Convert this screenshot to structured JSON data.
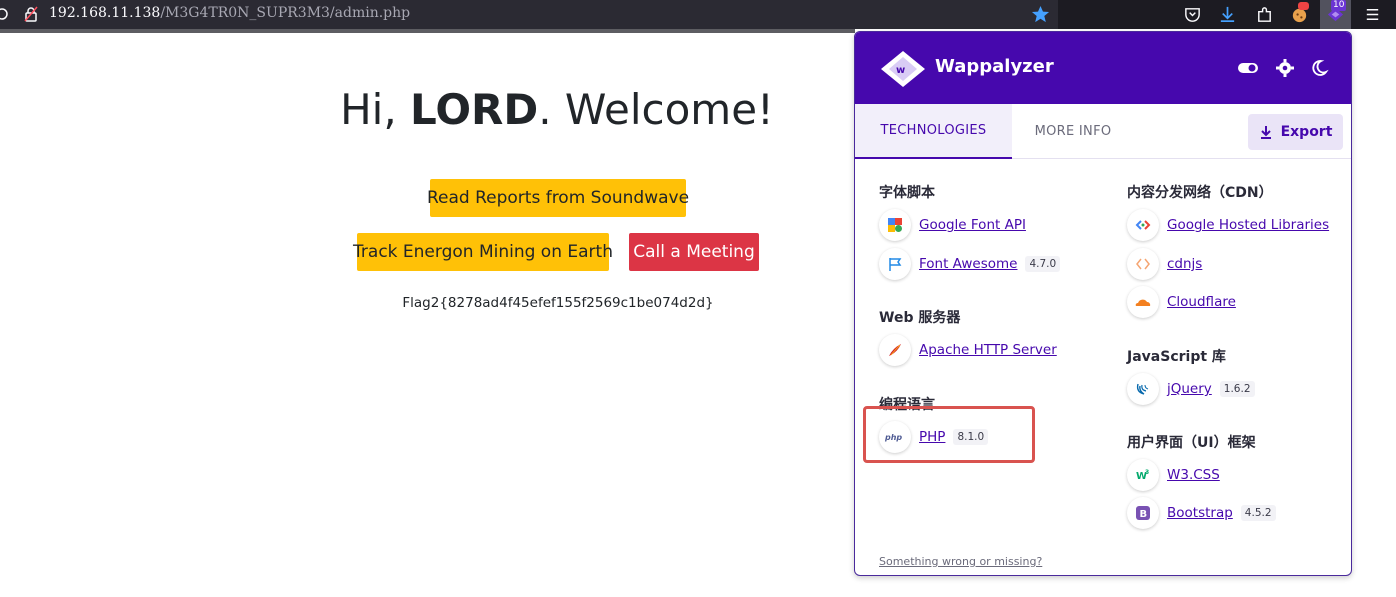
{
  "browser": {
    "url_host": "192.168.11.138",
    "url_path": "/M3G4TR0N_SUPR3M3/admin.php",
    "extension_badge": "10"
  },
  "page": {
    "title_prefix": "Hi, ",
    "title_name": "LORD",
    "title_suffix": ". Welcome!",
    "buttons": {
      "read_reports": "Read Reports from Soundwave",
      "track_energon": "Track Energon Mining on Earth",
      "call_meeting": "Call a Meeting"
    },
    "flag": "Flag2{8278ad4f45efef155f2569c1be074d2d}"
  },
  "wappalyzer": {
    "name": "Wappalyzer",
    "tabs": {
      "technologies": "TECHNOLOGIES",
      "more_info": "MORE INFO"
    },
    "export_label": "Export",
    "categories_left": [
      {
        "title": "字体脚本",
        "techs": [
          {
            "name": "Google Font API",
            "version": "",
            "icon": "google-font-icon"
          },
          {
            "name": "Font Awesome",
            "version": "4.7.0",
            "icon": "font-awesome-icon"
          }
        ]
      },
      {
        "title": "Web 服务器",
        "techs": [
          {
            "name": "Apache HTTP Server",
            "version": "",
            "icon": "apache-feather-icon"
          }
        ]
      },
      {
        "title": "编程语言",
        "techs": [
          {
            "name": "PHP",
            "version": "8.1.0",
            "icon": "php-icon"
          }
        ]
      }
    ],
    "categories_right": [
      {
        "title": "内容分发网络（CDN）",
        "techs": [
          {
            "name": "Google Hosted Libraries",
            "version": "",
            "icon": "google-hosted-icon"
          },
          {
            "name": "cdnjs",
            "version": "",
            "icon": "cdnjs-icon"
          },
          {
            "name": "Cloudflare",
            "version": "",
            "icon": "cloudflare-icon"
          }
        ]
      },
      {
        "title": "JavaScript 库",
        "techs": [
          {
            "name": "jQuery",
            "version": "1.6.2",
            "icon": "jquery-icon"
          }
        ]
      },
      {
        "title": "用户界面（UI）框架",
        "techs": [
          {
            "name": "W3.CSS",
            "version": "",
            "icon": "w3css-icon"
          },
          {
            "name": "Bootstrap",
            "version": "4.5.2",
            "icon": "bootstrap-icon"
          }
        ]
      }
    ],
    "footer_link": "Something wrong or missing?"
  }
}
